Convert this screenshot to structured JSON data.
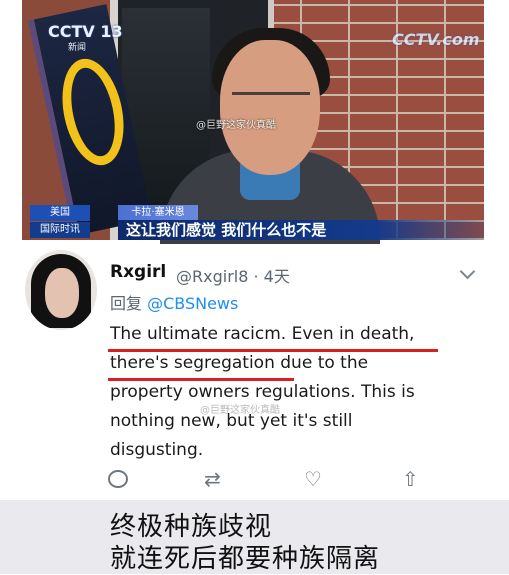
{
  "video": {
    "logo_left": "CCTV 13",
    "logo_left_sub": "新闻",
    "logo_right": "CCTV.com",
    "weibo_watermark": "@巨野这家伙真酷",
    "tag_country": "美国",
    "tag_program": "国际时讯",
    "speaker_name": "卡拉·塞米恩",
    "subtitle": "这让我们感觉 我们什么也不是",
    "sign_letter": "O"
  },
  "tweet": {
    "display_name": "Rxgirl",
    "handle_time": "@Rxgirl8 · 4天",
    "reply_prefix": "回复 ",
    "reply_to": "@CBSNews",
    "body_lines": [
      "The ultimate racicm. Even in death,",
      "there's segregation due to the",
      "property owners regulations. This is",
      "nothing new, but yet it's still",
      "disgusting."
    ],
    "watermark": "@巨野这家伙真酷",
    "icons": {
      "reply": "reply-icon",
      "retweet": "retweet-icon",
      "like": "like-icon",
      "share": "share-icon"
    },
    "accent_color": "#1d8ff0",
    "underline_color": "#d92020"
  },
  "caption": {
    "line1": "终极种族歧视",
    "line2": "就连死后都要种族隔离"
  }
}
